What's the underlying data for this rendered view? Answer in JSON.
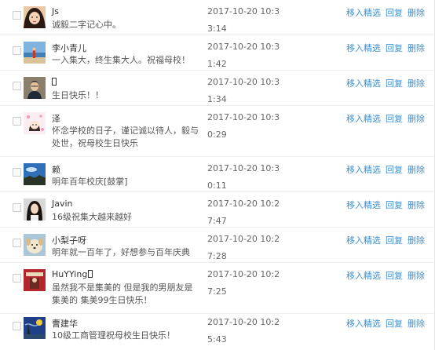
{
  "comments": [
    {
      "name": "Js",
      "text": "诚毅二字记心中。",
      "time": "2017-10-20 10:33:14",
      "avatar_icon": "girl-portrait-avatar"
    },
    {
      "name": "李小青儿",
      "text": "一入集大，终生集大人。祝福母校！",
      "time": "2017-10-20 10:31:42",
      "avatar_icon": "beach-scene-avatar"
    },
    {
      "name": "",
      "text": "生日快乐！！",
      "time": "2017-10-20 10:31:34",
      "avatar_icon": "man-portrait-avatar"
    },
    {
      "name": "泽",
      "text": "怀念学校的日子，谨记诚以待人，毅与处世，祝母校生日快乐",
      "time": "2017-10-20 10:30:29",
      "avatar_icon": "cartoon-girl-avatar"
    },
    {
      "name": "赖",
      "text": "明年百年校庆[鼓掌]",
      "time": "2017-10-20 10:30:11",
      "avatar_icon": "sky-landscape-avatar"
    },
    {
      "name": "Javin",
      "text": "16级祝集大越来越好",
      "time": "2017-10-20 10:27:47",
      "avatar_icon": "woman-portrait-avatar"
    },
    {
      "name": "小梨子呀",
      "text": "明年就一百年了，好想参与百年庆典",
      "time": "2017-10-20 10:27:28",
      "avatar_icon": "dog-avatar"
    },
    {
      "name": "HuYYing",
      "text": "虽然我不是集美的 但是我的男朋友是集美的 集美99生日快乐！",
      "time": "2017-10-20 10:27:25",
      "avatar_icon": "red-poster-avatar"
    },
    {
      "name": "曹建华",
      "text": "10级工商管理祝母校生日快乐！",
      "time": "2017-10-20 10:25:43",
      "avatar_icon": "van-gogh-painting-avatar"
    }
  ],
  "actions": {
    "feature": "移入精选",
    "reply": "回复",
    "delete": "删除"
  }
}
